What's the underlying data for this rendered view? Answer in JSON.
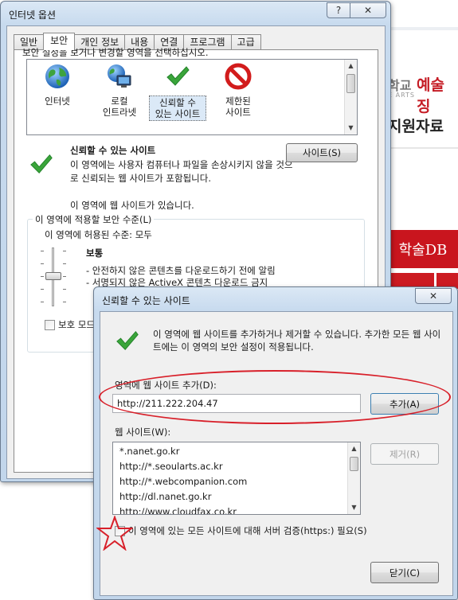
{
  "background": {
    "logo_left": "학교",
    "logo_right": "예술징",
    "logo_sub": "E ARTS",
    "heading": "지원자료",
    "db_label": "학술DB",
    "accent_color": "#c9151e"
  },
  "main_window": {
    "title": "인터넷 옵션",
    "help_label": "?",
    "close_label": "✕",
    "tabs": [
      "일반",
      "보안",
      "개인 정보",
      "내용",
      "연결",
      "프로그램",
      "고급"
    ],
    "active_tab": "보안",
    "zone_prompt": "보안 설정을 보거나 변경할 영역을 선택하십시오.",
    "zones": [
      {
        "line1": "인터넷",
        "line2": "",
        "icon": "globe-icon"
      },
      {
        "line1": "로컬",
        "line2": "인트라넷",
        "icon": "intranet-icon"
      },
      {
        "line1": "신뢰할 수",
        "line2": "있는 사이트",
        "icon": "checkmark-icon"
      },
      {
        "line1": "제한된",
        "line2": "사이트",
        "icon": "no-entry-icon"
      }
    ],
    "selected_zone": {
      "title": "신뢰할 수 있는 사이트",
      "description": "이 영역에는 사용자 컴퓨터나 파일을 손상시키지 않을 것으로 신뢰되는 웹 사이트가 포함됩니다.",
      "note": "이 영역에 웹 사이트가 있습니다.",
      "sites_button": "사이트(S)"
    },
    "security_level": {
      "legend": "이 영역에 적용할 보안 수준(L)",
      "allowed": "이 영역에 허용된 수준: 모두",
      "level_name": "보통",
      "bullets": [
        "- 안전하지 않은 콘텐츠를 다운로드하기 전에 알림",
        "- 서명되지 않은 ActiveX 콘텐츠 다운로드 금지"
      ],
      "protected_mode_label": "보호 모드"
    }
  },
  "trusted_sites_dialog": {
    "title": "신뢰할 수 있는 사이트",
    "close_label": "✕",
    "description": "이 영역에 웹 사이트를 추가하거나 제거할 수 있습니다. 추가한 모든 웹 사이트에는 이 영역의 보안 설정이 적용됩니다.",
    "add_label": "영역에 웹 사이트 추가(D):",
    "add_value": "http://211.222.204.47",
    "add_button": "추가(A)",
    "list_label": "웹 사이트(W):",
    "sites": [
      "*.nanet.go.kr",
      "http://*.seoularts.ac.kr",
      "http://*.webcompanion.com",
      "http://dl.nanet.go.kr",
      "http://www.cloudfax.co.kr"
    ],
    "remove_button": "제거(R)",
    "https_label": "이 영역에 있는 모든 사이트에 대해 서버 검증(https:) 필요(S)",
    "close_button": "닫기(C)"
  },
  "annotation_color": "#d8202a"
}
